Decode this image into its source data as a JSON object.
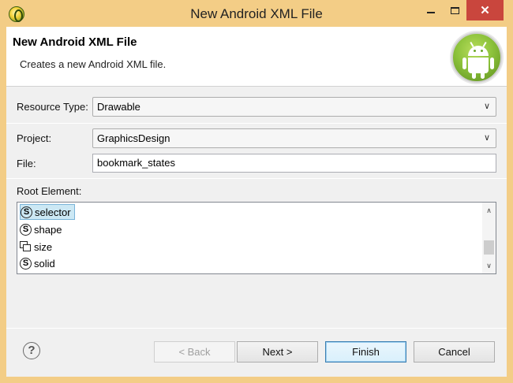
{
  "window": {
    "title": "New Android XML File",
    "close_glyph": "✕"
  },
  "header": {
    "title": "New Android XML File",
    "description": "Creates a new Android XML file."
  },
  "form": {
    "resource_type_label": "Resource Type:",
    "resource_type_value": "Drawable",
    "project_label": "Project:",
    "project_value": "GraphicsDesign",
    "file_label": "File:",
    "file_value": "bookmark_states",
    "root_element_label": "Root Element:"
  },
  "root_elements": [
    {
      "label": "selector",
      "icon": "s-circle-icon",
      "selected": true
    },
    {
      "label": "shape",
      "icon": "s-circle-icon",
      "selected": false
    },
    {
      "label": "size",
      "icon": "size-icon",
      "selected": false
    },
    {
      "label": "solid",
      "icon": "s-circle-icon",
      "selected": false
    }
  ],
  "buttons": {
    "back": "< Back",
    "next": "Next >",
    "finish": "Finish",
    "cancel": "Cancel",
    "help_glyph": "?"
  },
  "colors": {
    "titlebar": "#f3cd86",
    "close_button": "#c9463d",
    "selection": "#cce8f4",
    "android_green": "#8cc23b"
  }
}
